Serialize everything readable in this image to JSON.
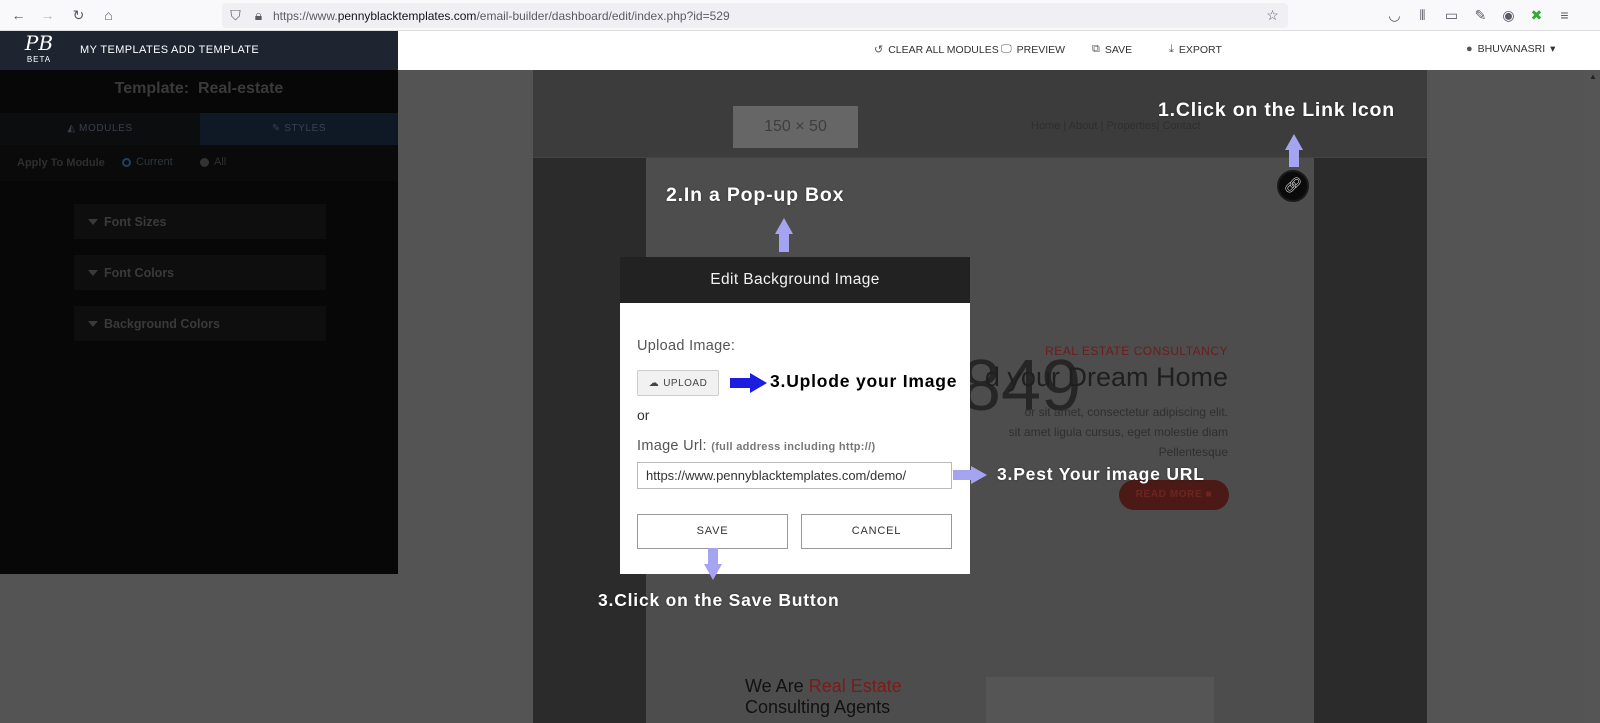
{
  "browser": {
    "url_prefix": "https://www.",
    "url_domain": "pennyblacktemplates.com",
    "url_path": "/email-builder/dashboard/edit/index.php?id=529"
  },
  "app": {
    "logo_monogram": "PB",
    "logo_badge": "BETA",
    "nav": [
      "MY TEMPLATES",
      "ADD TEMPLATE"
    ],
    "toolbar": {
      "clear": "CLEAR ALL MODULES",
      "preview": "PREVIEW",
      "save": "SAVE",
      "export": "EXPORT"
    },
    "user": "BHUVANASRI"
  },
  "sidebar": {
    "template_label": "Template:",
    "template_name": "Real-estate",
    "tabs": [
      "MODULES",
      "STYLES"
    ],
    "apply_label": "Apply To Module",
    "apply_options": [
      "Current",
      "All"
    ],
    "apply_selected": "Current",
    "sections": [
      "Font Sizes",
      "Font Colors",
      "Background Colors"
    ]
  },
  "template": {
    "logo_placeholder": "150 × 50",
    "nav_links": "Home | About | Properties| Contact",
    "hero_subtitle": "REAL ESTATE CONSULTANCY",
    "hero_title": "d your Dream Home",
    "hero_placeholder": "x 849",
    "hero_text": [
      "or sit amet, consectetur adipiscing elit.",
      "sit amet ligula cursus, eget molestie diam",
      "Pellentesque"
    ],
    "read_more": "READ MORE",
    "section_title_a": "We Are ",
    "section_title_red": "Real Estate",
    "section_title_b": "Consulting Agents"
  },
  "modal": {
    "title": "Edit Background Image",
    "upload_label": "Upload Image:",
    "upload_button": "UPLOAD",
    "or": "or",
    "url_label": "Image Url:",
    "url_hint": "(full address including http://)",
    "url_value": "https://www.pennyblacktemplates.com/demo/",
    "save": "SAVE",
    "cancel": "CANCEL"
  },
  "annotations": {
    "step1": "1.Click on the Link Icon",
    "step2": "2.In a Pop-up Box",
    "step3a": "3.Uplode your Image",
    "step3b": "3.Pest Your image URL",
    "step3c": "3.Click on the Save Button"
  },
  "colors": {
    "annotation_arrow_light": "#a4a4f0",
    "annotation_arrow_dark": "#1d1de0",
    "app_header": "#1e2530",
    "accent_red": "#c0392b"
  }
}
